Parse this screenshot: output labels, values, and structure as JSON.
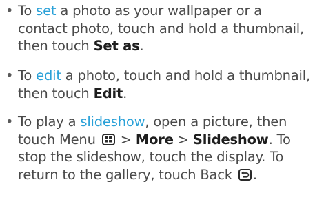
{
  "items": [
    {
      "bullet": "•",
      "parts": [
        "To ",
        "set",
        " a photo as your wallpaper or a contact photo, touch and hold a thumbnail, then touch ",
        "Set as",
        "."
      ]
    },
    {
      "bullet": "•",
      "parts": [
        "To ",
        "edit",
        " a photo, touch and hold a thumbnail, then touch ",
        "Edit",
        "."
      ]
    },
    {
      "bullet": "•",
      "parts": [
        "To play a ",
        "slideshow",
        ", open a picture, then touch Menu ",
        " > ",
        "More",
        " > ",
        "Slideshow",
        ". To stop the slideshow, touch the display. To return to the gallery, touch Back ",
        "."
      ]
    }
  ],
  "icons": {
    "menu": "menu-key-icon",
    "back": "back-key-icon"
  },
  "colors": {
    "text": "#4a4a4a",
    "link": "#2aa1d8",
    "bold": "#1e1e1e"
  }
}
